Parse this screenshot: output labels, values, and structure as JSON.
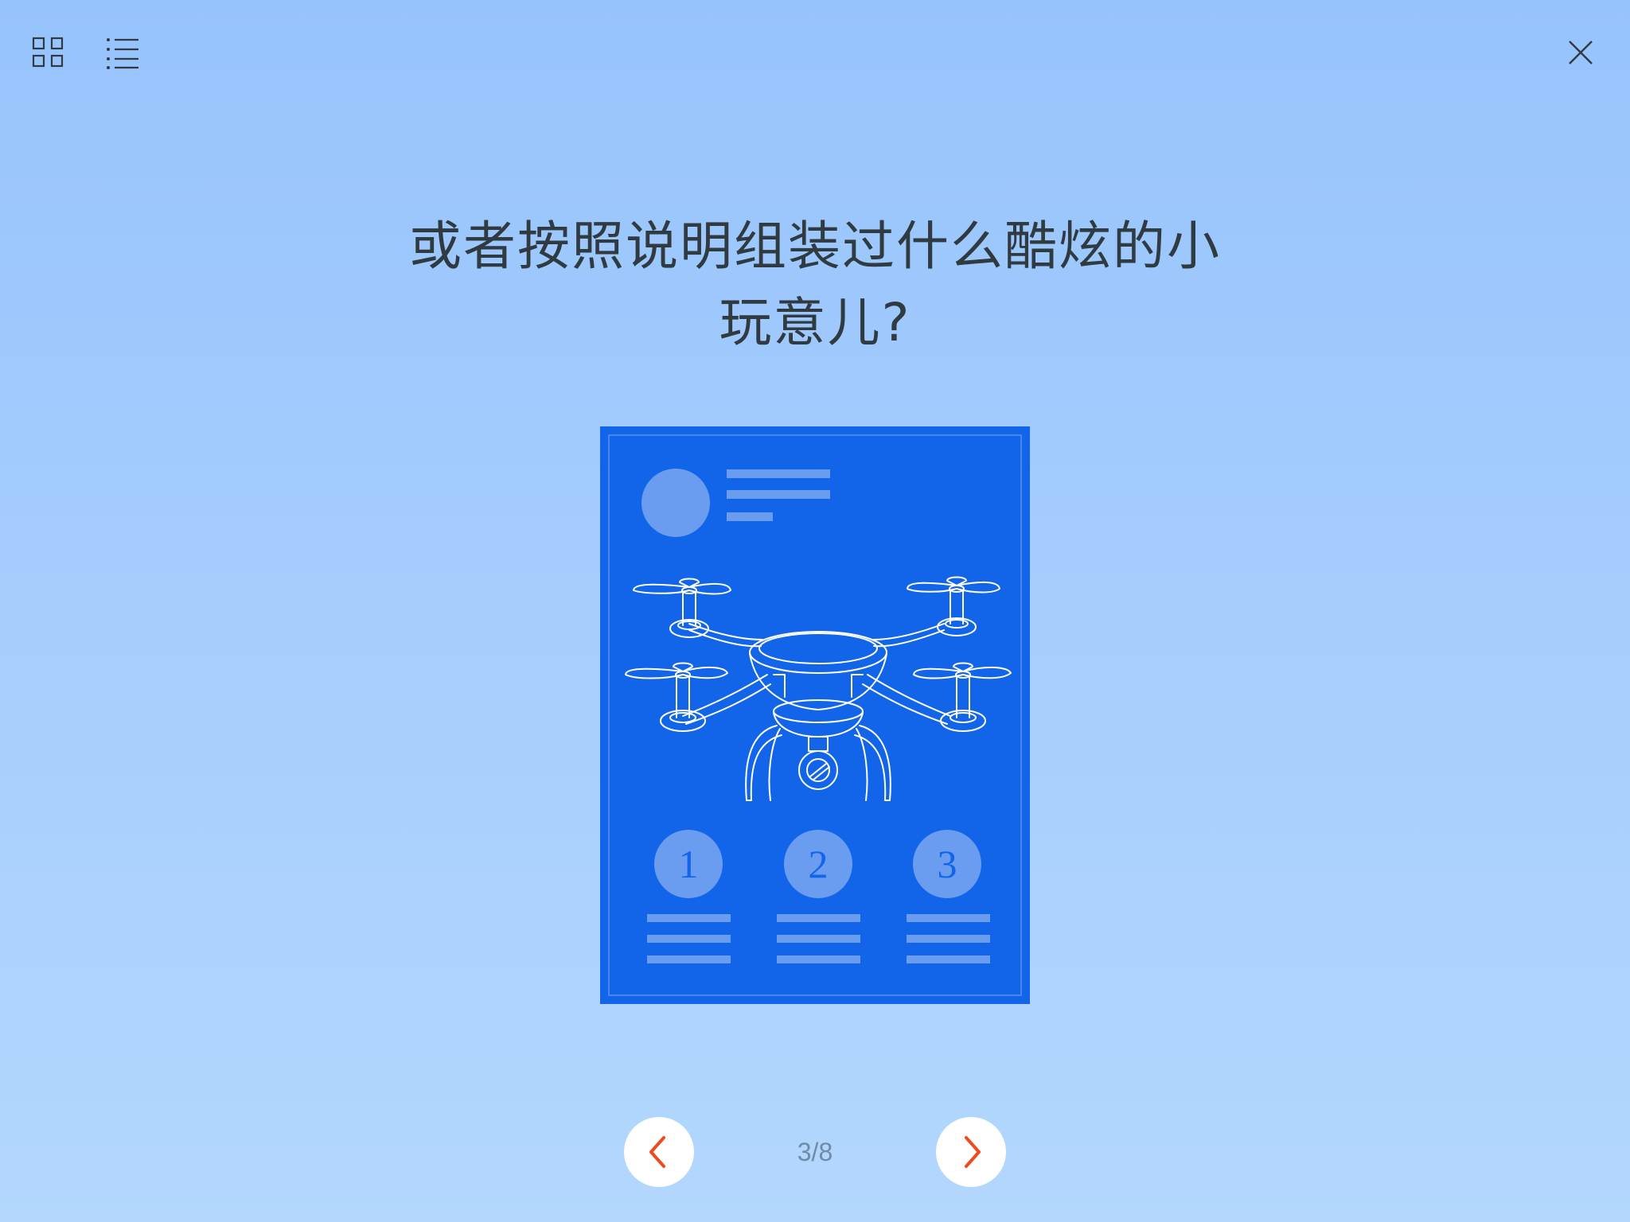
{
  "toolbar": {
    "grid_icon": "grid-view-icon",
    "list_icon": "list-view-icon",
    "close_icon": "close-icon"
  },
  "slide": {
    "title_line1": "或者按照说明组装过什么酷炫的小",
    "title_line2": "玩意儿?",
    "illustration": "drone-instruction-manual",
    "steps": [
      "1",
      "2",
      "3"
    ]
  },
  "navigation": {
    "prev_icon": "chevron-left-icon",
    "next_icon": "chevron-right-icon",
    "page_indicator": "3/8"
  },
  "colors": {
    "background_top": "#97c3fd",
    "background_bottom": "#b3d7fd",
    "manual_blue": "#1265e8",
    "manual_accent": "#6a9cf0",
    "arrow_color": "#f04a22",
    "title_color": "#2f3b40"
  }
}
